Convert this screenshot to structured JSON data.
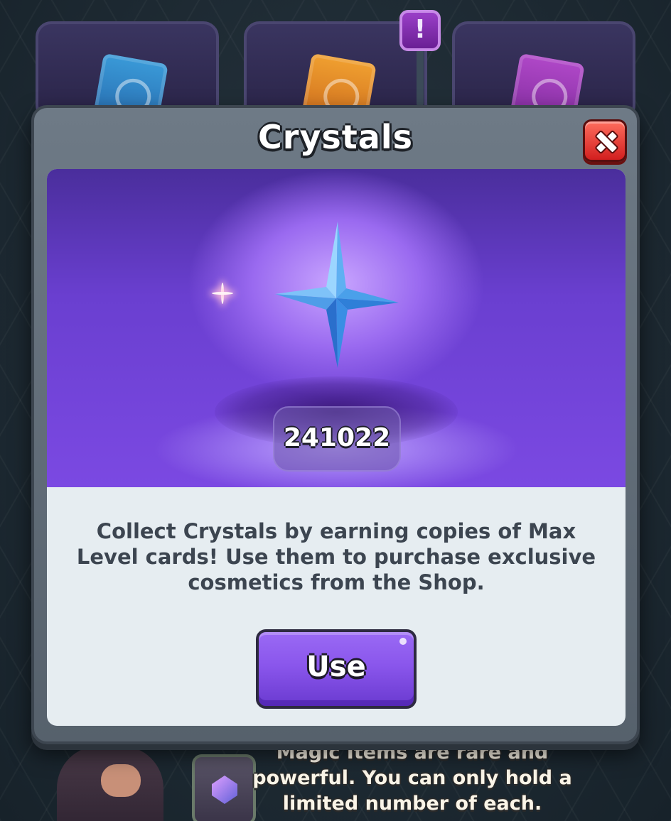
{
  "modal": {
    "title": "Crystals",
    "crystal_amount": "241022",
    "description": "Collect Crystals by earning copies of Max Level cards! Use them to purchase exclusive cosmetics from the Shop.",
    "use_button_label": "Use"
  },
  "background": {
    "alert_badge": "!",
    "info_text": "Magic Items are rare and powerful. You can only hold a limited number of each."
  },
  "colors": {
    "crystal": "#4a9ee8",
    "panel_purple": "#7b49e2",
    "close_red": "#d21f1f",
    "use_button": "#8a56ec"
  }
}
